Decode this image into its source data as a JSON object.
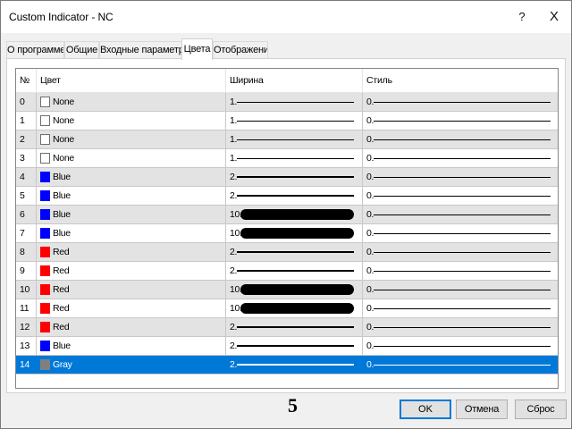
{
  "window": {
    "title": "Custom Indicator - NC",
    "help_glyph": "?",
    "close_glyph": "X"
  },
  "tabs": [
    {
      "label": "О программе",
      "active": false
    },
    {
      "label": "Общие",
      "active": false
    },
    {
      "label": "Входные параметры",
      "active": false
    },
    {
      "label": "Цвета",
      "active": true
    },
    {
      "label": "Отображение",
      "active": false
    }
  ],
  "grid": {
    "columns": [
      "№",
      "Цвет",
      "Ширина",
      "Стиль"
    ],
    "rows": [
      {
        "num": "0",
        "color_name": "None",
        "swatch": "#ffffff",
        "width_label": "1.",
        "width": 1,
        "style_label": "0."
      },
      {
        "num": "1",
        "color_name": "None",
        "swatch": "#ffffff",
        "width_label": "1.",
        "width": 1,
        "style_label": "0."
      },
      {
        "num": "2",
        "color_name": "None",
        "swatch": "#ffffff",
        "width_label": "1.",
        "width": 1,
        "style_label": "0."
      },
      {
        "num": "3",
        "color_name": "None",
        "swatch": "#ffffff",
        "width_label": "1.",
        "width": 1,
        "style_label": "0."
      },
      {
        "num": "4",
        "color_name": "Blue",
        "swatch": "#0000ff",
        "width_label": "2.",
        "width": 2,
        "style_label": "0."
      },
      {
        "num": "5",
        "color_name": "Blue",
        "swatch": "#0000ff",
        "width_label": "2.",
        "width": 2,
        "style_label": "0."
      },
      {
        "num": "6",
        "color_name": "Blue",
        "swatch": "#0000ff",
        "width_label": "10.",
        "width": 10,
        "style_label": "0."
      },
      {
        "num": "7",
        "color_name": "Blue",
        "swatch": "#0000ff",
        "width_label": "10.",
        "width": 10,
        "style_label": "0."
      },
      {
        "num": "8",
        "color_name": "Red",
        "swatch": "#ff0000",
        "width_label": "2.",
        "width": 2,
        "style_label": "0."
      },
      {
        "num": "9",
        "color_name": "Red",
        "swatch": "#ff0000",
        "width_label": "2.",
        "width": 2,
        "style_label": "0."
      },
      {
        "num": "10",
        "color_name": "Red",
        "swatch": "#ff0000",
        "width_label": "10.",
        "width": 10,
        "style_label": "0."
      },
      {
        "num": "11",
        "color_name": "Red",
        "swatch": "#ff0000",
        "width_label": "10.",
        "width": 10,
        "style_label": "0."
      },
      {
        "num": "12",
        "color_name": "Red",
        "swatch": "#ff0000",
        "width_label": "2.",
        "width": 2,
        "style_label": "0."
      },
      {
        "num": "13",
        "color_name": "Blue",
        "swatch": "#0000ff",
        "width_label": "2.",
        "width": 2,
        "style_label": "0."
      },
      {
        "num": "14",
        "color_name": "Gray",
        "swatch": "#808080",
        "width_label": "2.",
        "width": 2,
        "style_label": "0.",
        "selected": true
      }
    ]
  },
  "footer": {
    "page_marker": "5",
    "ok_label": "OK",
    "cancel_label": "Отмена",
    "reset_label": "Сброс"
  },
  "colors": {
    "selection": "#0078d7",
    "row_alt": "#e3e3e3",
    "default_button_border": "#0078d7"
  }
}
